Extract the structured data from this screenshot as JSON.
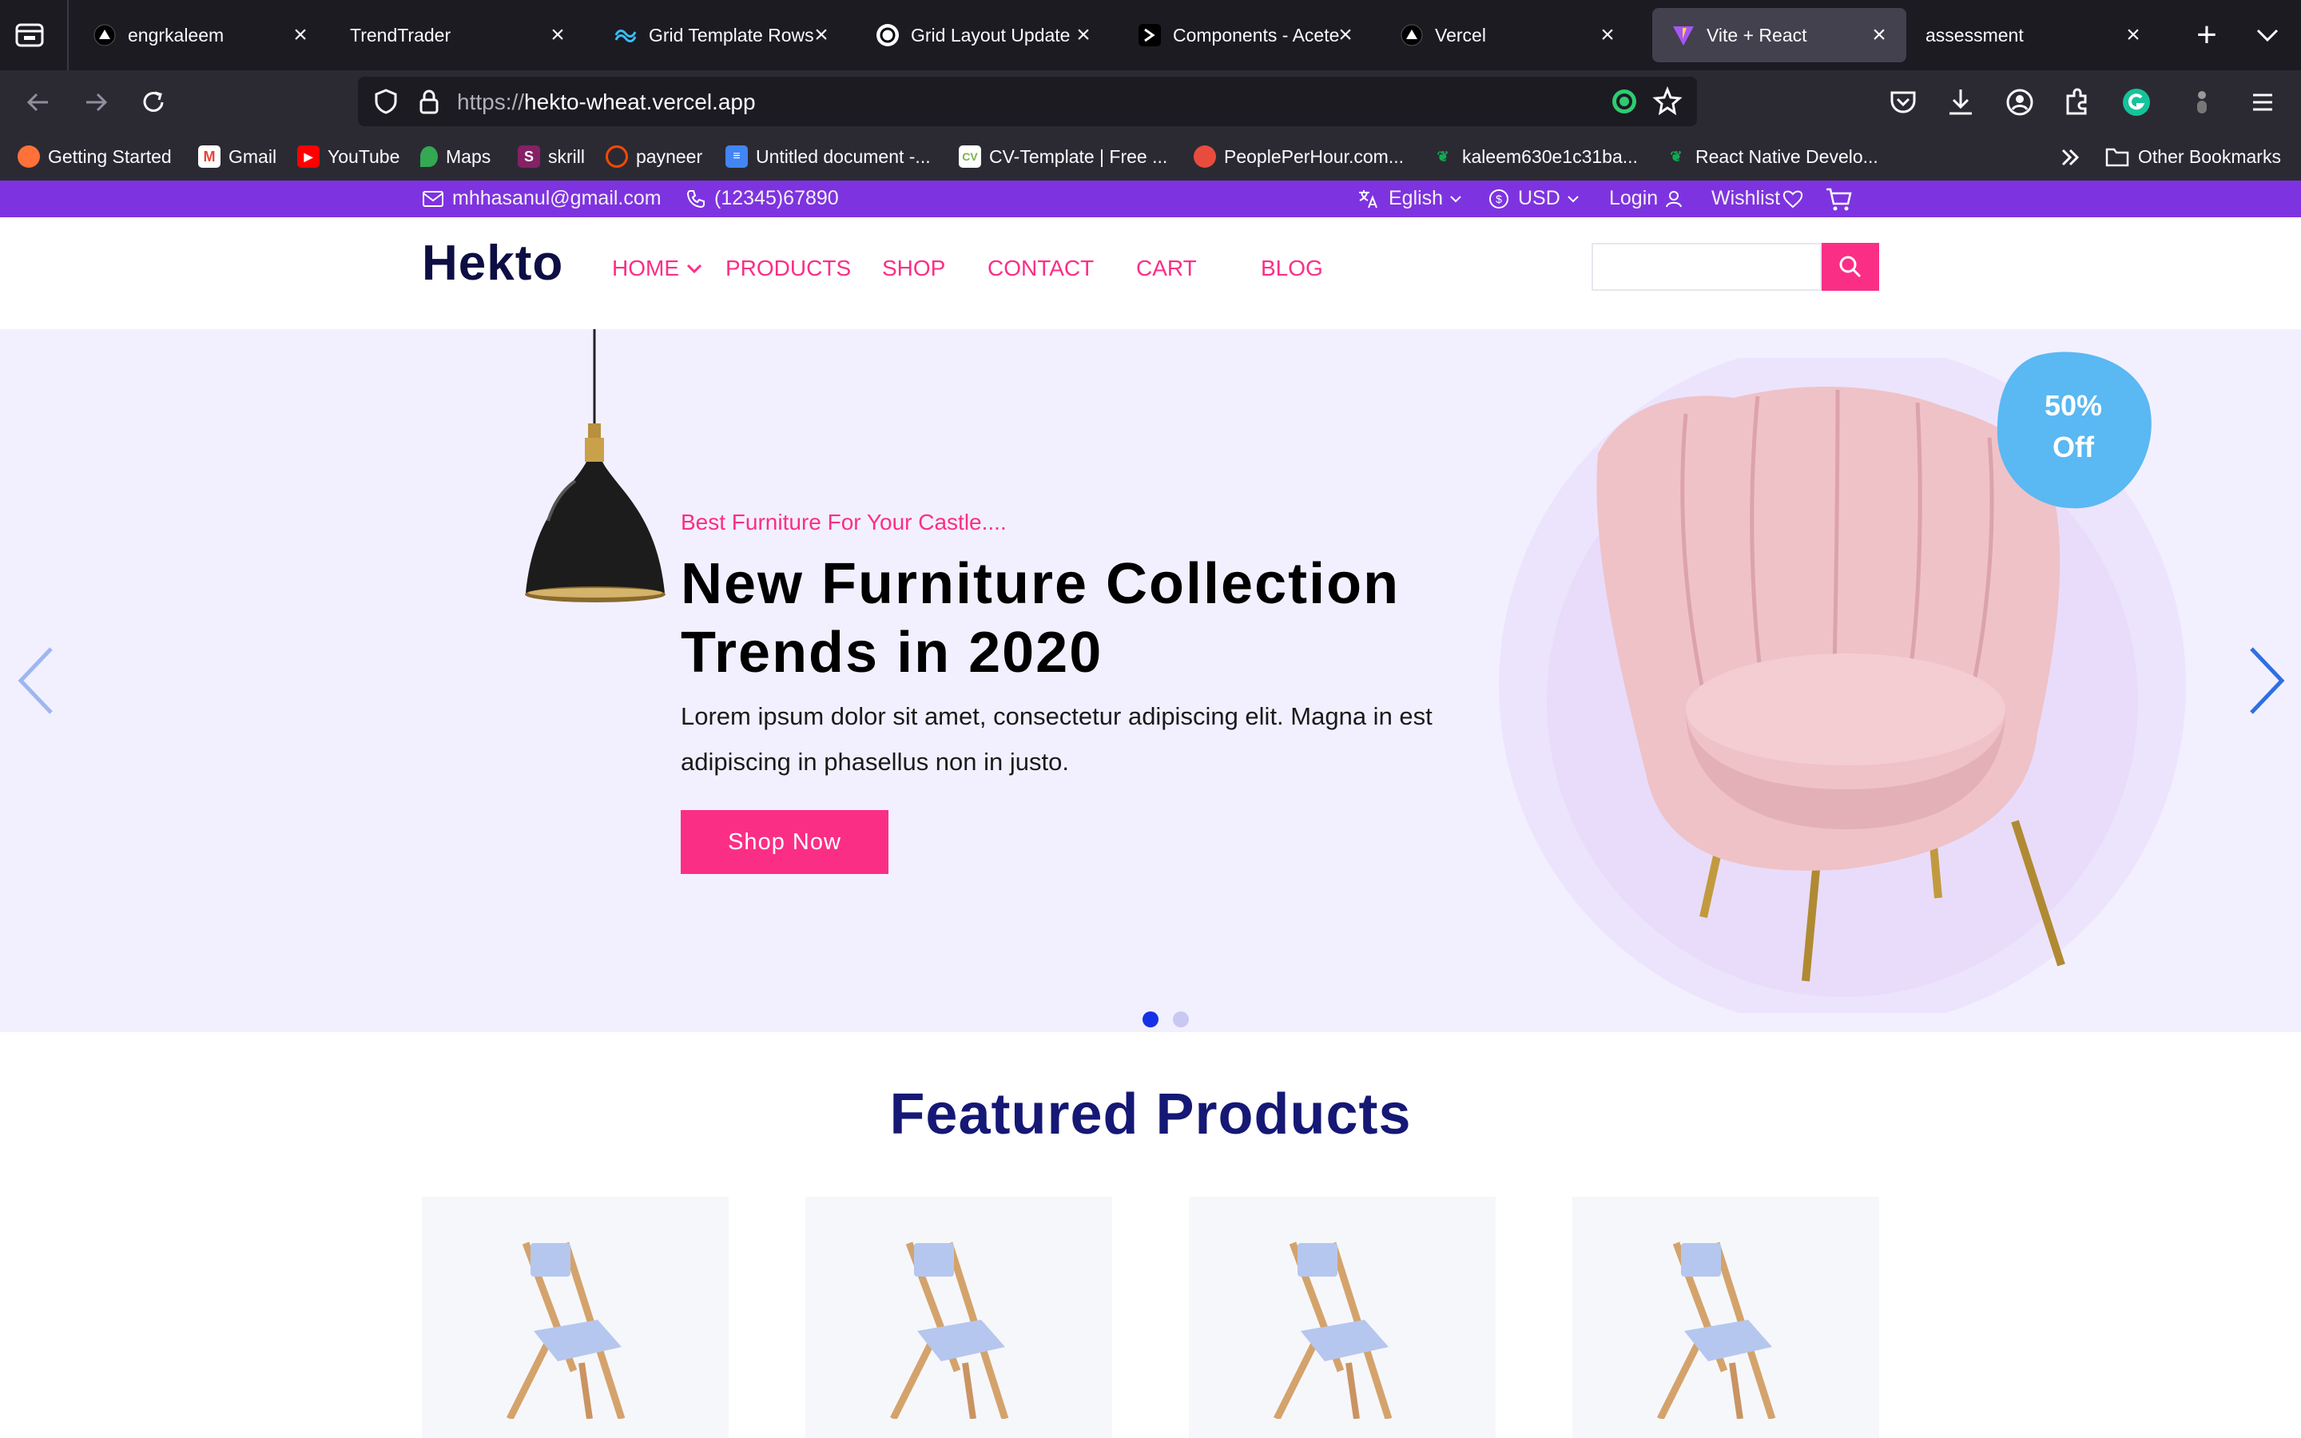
{
  "browser": {
    "tabs": [
      {
        "title": "engrkaleem",
        "icon": "vercel-triangle-icon"
      },
      {
        "title": "TrendTrader",
        "icon": "none"
      },
      {
        "title": "Grid Template Rows",
        "icon": "tailwind-icon"
      },
      {
        "title": "Grid Layout Update",
        "icon": "openai-icon"
      },
      {
        "title": "Components - Acete",
        "icon": "aceternity-icon"
      },
      {
        "title": "Vercel",
        "icon": "vercel-triangle-icon"
      },
      {
        "title": "Vite + React",
        "icon": "vite-icon"
      },
      {
        "title": "assessment",
        "icon": "none"
      }
    ],
    "url_prefix": "https://",
    "url_host": "hekto-wheat.vercel.app",
    "bookmarks": [
      {
        "label": "Getting Started",
        "icon": "firefox-icon",
        "color": "#ff7139"
      },
      {
        "label": "Gmail",
        "icon": "gmail-icon",
        "color": "#ea4335"
      },
      {
        "label": "YouTube",
        "icon": "youtube-icon",
        "color": "#ff0000"
      },
      {
        "label": "Maps",
        "icon": "maps-pin-icon",
        "color": "#34a853"
      },
      {
        "label": "skrill",
        "icon": "skrill-icon",
        "color": "#862165"
      },
      {
        "label": "payneer",
        "icon": "payoneer-icon",
        "color": "#ff4800"
      },
      {
        "label": "Untitled document -...",
        "icon": "google-docs-icon",
        "color": "#4285f4"
      },
      {
        "label": "CV-Template | Free ...",
        "icon": "cv-template-icon",
        "color": "#7cb342"
      },
      {
        "label": "PeoplePerHour.com...",
        "icon": "peopleperhour-icon",
        "color": "#e84c3d"
      },
      {
        "label": "kaleem630e1c31ba...",
        "icon": "mongodb-leaf-icon",
        "color": "#13aa52"
      },
      {
        "label": "React Native Develo...",
        "icon": "mongodb-leaf-icon",
        "color": "#13aa52"
      }
    ],
    "other_bookmarks": "Other Bookmarks"
  },
  "topbar": {
    "email": "mhhasanul@gmail.com",
    "phone": "(12345)67890",
    "language": "Eglish",
    "currency": "USD",
    "login": "Login",
    "wishlist": "Wishlist"
  },
  "header": {
    "logo": "Hekto",
    "menu": [
      "HOME",
      "PRODUCTS",
      "SHOP",
      "CONTACT",
      "CART",
      "BLOG"
    ],
    "search_placeholder": ""
  },
  "hero": {
    "subtitle": "Best Furniture For Your Castle....",
    "title": "New Furniture Collection Trends in 2020",
    "text": "Lorem ipsum dolor sit amet, consectetur adipiscing elit. Magna in est adipiscing in phasellus non in justo.",
    "button": "Shop Now",
    "badge_line1": "50%",
    "badge_line2": "Off",
    "active_slide": 1,
    "slide_count": 2
  },
  "featured": {
    "heading": "Featured Products",
    "product_count": 4
  },
  "colors": {
    "accent": "#fb2e86",
    "topbar": "#7e33e0",
    "navy": "#151875",
    "hero_bg": "#f2f0ff",
    "badge": "#5ab8f2"
  }
}
